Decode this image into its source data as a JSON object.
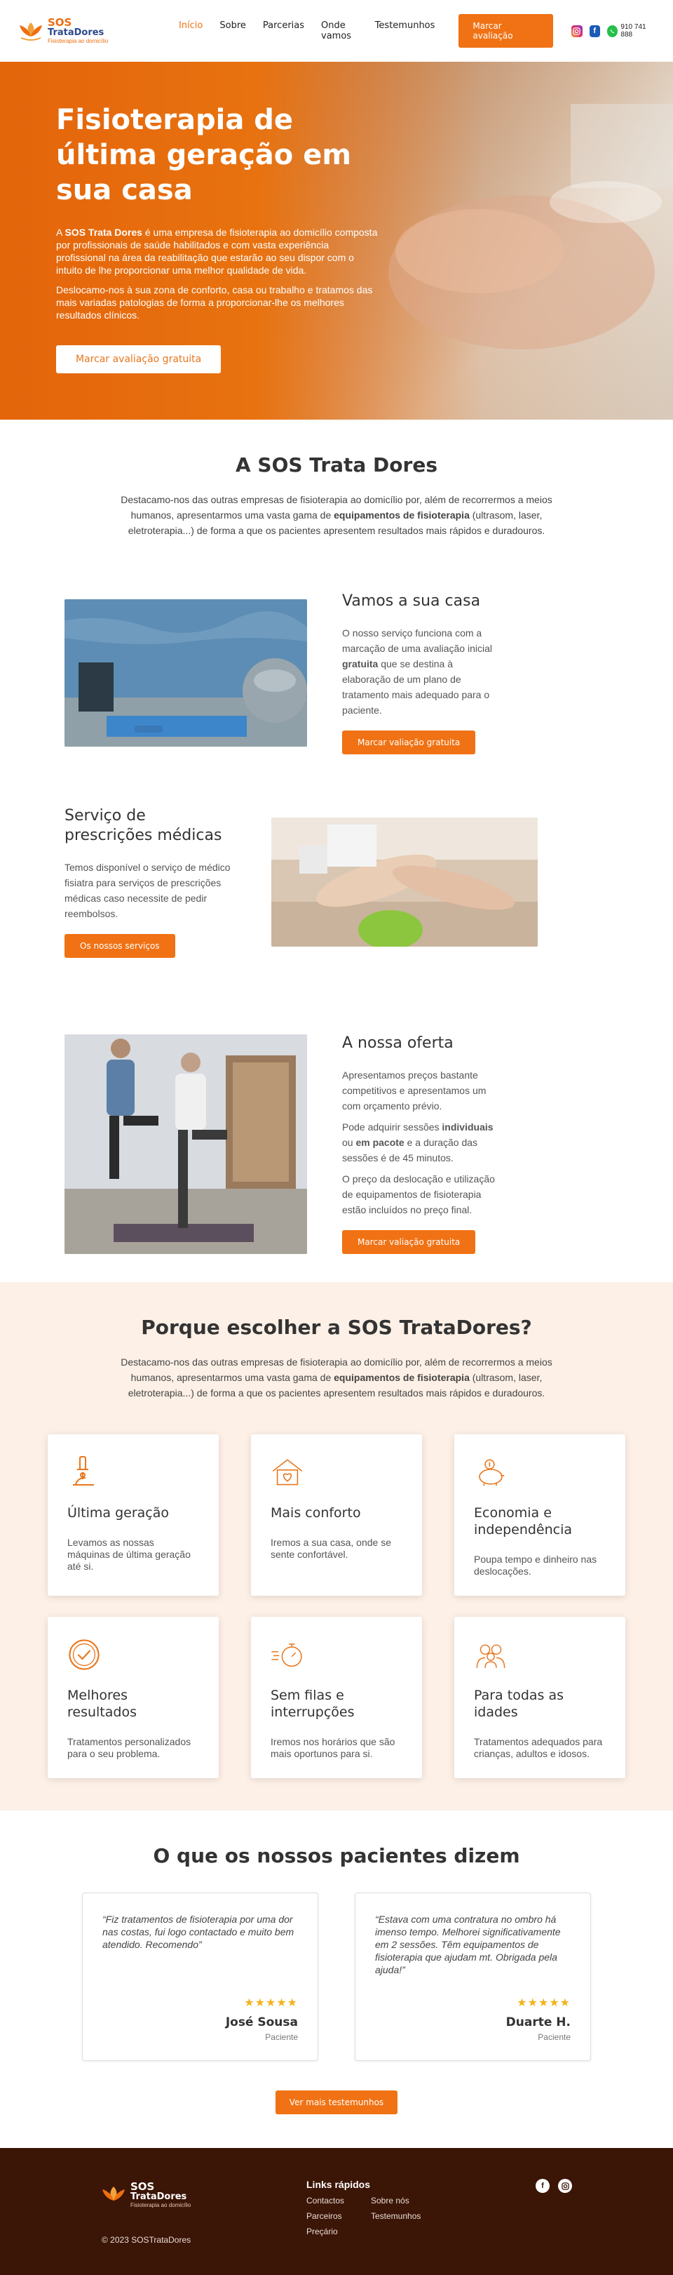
{
  "header": {
    "logo": {
      "line1": "SOS",
      "line2": "TrataDores",
      "tagline": "Fisioterapia ao domicílio"
    },
    "nav": [
      {
        "label": "Início"
      },
      {
        "label": "Sobre"
      },
      {
        "label": "Parcerias"
      },
      {
        "label": "Onde vamos"
      },
      {
        "label": "Testemunhos"
      }
    ],
    "cta_label": "Marcar avaliação",
    "phone": "910 741 888",
    "social_icons": [
      "instagram-icon",
      "facebook-icon",
      "whatsapp-icon"
    ]
  },
  "hero": {
    "title": "Fisioterapia de última geração em sua casa",
    "p1_before": "A ",
    "p1_bold": "SOS Trata Dores",
    "p1_after": " é uma empresa de fisioterapia ao domicílio composta por profissionais de saúde habilitados e com vasta experiência profissional na área da reabilitação que estarão ao seu dispor com o intuito de lhe proporcionar uma melhor qualidade de vida.",
    "p2": "Deslocamo-nos à sua zona de conforto, casa ou trabalho e tratamos das mais variadas patologias de forma a proporcionar-lhe os melhores resultados clínicos.",
    "cta_label": "Marcar avaliação gratuita"
  },
  "about": {
    "title": "A SOS Trata Dores",
    "intro_before": "Destacamo-nos das outras empresas de fisioterapia ao domicílio por, além de recorrermos a meios humanos, apresentarmos uma vasta gama de ",
    "intro_bold": "equipamentos de fisioterapia",
    "intro_after": " (ultrasom, laser, eletroterapia...) de forma a que os pacientes apresentem resultados mais rápidos e duradouros."
  },
  "features": [
    {
      "title": "Vamos a sua casa",
      "p_before": "O nosso serviço funciona com a marcação de uma avaliação inicial ",
      "p_bold": "gratuita",
      "p_after": " que se destina à elaboração de um plano de tratamento mais adequado para o paciente.",
      "cta_label": "Marcar valiação gratuita"
    },
    {
      "title": "Serviço de prescrições médicas",
      "p": "Temos disponível o serviço de médico fisiatra para serviços de prescrições médicas caso necessite de pedir reembolsos.",
      "cta_label": "Os nossos serviços"
    },
    {
      "title": "A nossa oferta",
      "p1": "Apresentamos preços bastante competitivos e apresentamos um com orçamento prévio.",
      "p2_a": "Pode adquirir sessões ",
      "p2_b": "individuais",
      "p2_c": " ou ",
      "p2_d": "em pacote",
      "p2_e": " e a duração das sessões é de 45 minutos.",
      "p3": "O preço da deslocação e utilização de equipamentos de fisioterapia estão incluídos no preço final.",
      "cta_label": "Marcar valiação gratuita"
    }
  ],
  "why": {
    "title": "Porque escolher a SOS TrataDores?",
    "intro_before": "Destacamo-nos das outras empresas de fisioterapia ao domicílio por, além de recorrermos a meios humanos, apresentarmos uma vasta gama de ",
    "intro_bold": "equipamentos de fisioterapia",
    "intro_after": " (ultrasom, laser, eletroterapia...) de forma a que os pacientes apresentem resultados mais rápidos e duradouros.",
    "cards": [
      {
        "icon": "microscope-icon",
        "title": "Última geração",
        "text": "Levamos as nossas máquinas de última geração até si."
      },
      {
        "icon": "house-heart-icon",
        "title": "Mais conforto",
        "text": "Iremos a sua casa, onde se sente confortável."
      },
      {
        "icon": "piggy-bank-icon",
        "title": "Economia e independência",
        "text": "Poupa tempo e dinheiro nas deslocações."
      },
      {
        "icon": "check-badge-icon",
        "title": "Melhores resultados",
        "text": "Tratamentos personalizados para o seu problema."
      },
      {
        "icon": "stopwatch-icon",
        "title": "Sem filas e interrupções",
        "text": "Iremos nos horários que são mais oportunos para si."
      },
      {
        "icon": "family-icon",
        "title": "Para todas as idades",
        "text": "Tratamentos adequados para crianças, adultos e idosos."
      }
    ]
  },
  "testimonials": {
    "title": "O que os nossos pacientes dizem",
    "items": [
      {
        "quote": "“Fiz tratamentos de fisioterapia por uma dor nas costas, fui logo contactado e muito bem atendido. Recomendo”",
        "stars": "★★★★★",
        "name": "José Sousa",
        "role": "Paciente"
      },
      {
        "quote": "“Estava com uma contratura no ombro há imenso tempo. Melhorei significativamente em 2 sessões. Têm equipamentos de fisioterapia que ajudam mt. Obrigada pela ajuda!”",
        "stars": "★★★★★",
        "name": "Duarte H.",
        "role": "Paciente"
      }
    ],
    "cta_label": "Ver mais testemunhos"
  },
  "footer": {
    "logo": {
      "line1": "SOS",
      "line2": "TrataDores",
      "tagline": "Fisioterapia ao domicílio"
    },
    "copyright": "© 2023 SOSTrataDores",
    "links_title": "Links rápidos",
    "links": [
      "Contactos",
      "Sobre nós",
      "Parceiros",
      "Testemunhos",
      "Preçário"
    ],
    "social_icons": [
      "facebook-icon",
      "instagram-icon"
    ]
  },
  "colors": {
    "accent": "#f07214",
    "footer_bg": "#3b1506",
    "why_bg": "#fdf0e6",
    "brand_blue": "#2c4a8c"
  }
}
